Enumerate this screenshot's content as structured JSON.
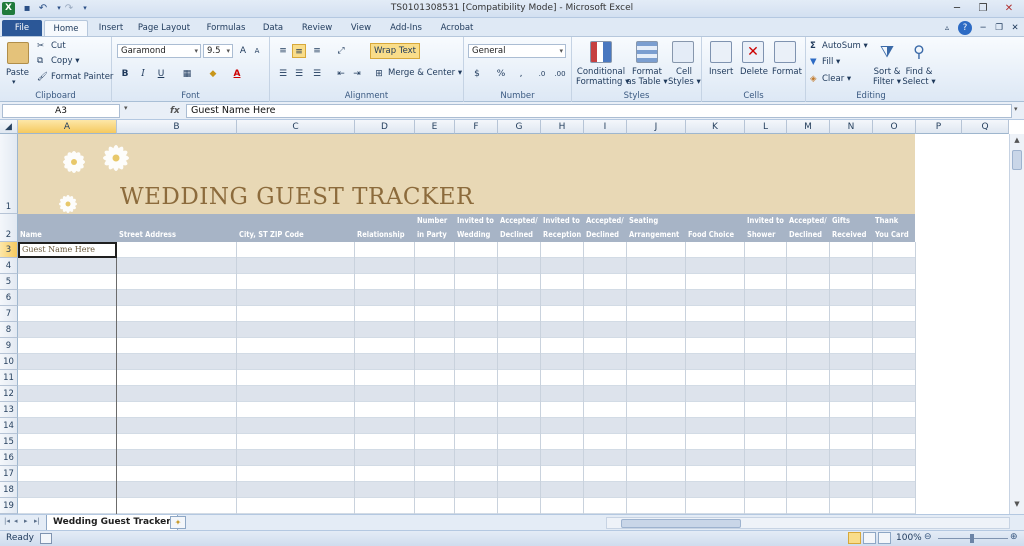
{
  "window": {
    "title": "TS0101308531  [Compatibility Mode]  -  Microsoft Excel"
  },
  "tabs": [
    "File",
    "Home",
    "Insert",
    "Page Layout",
    "Formulas",
    "Data",
    "Review",
    "View",
    "Add-Ins",
    "Acrobat"
  ],
  "ribbon": {
    "clipboard": {
      "label": "Clipboard",
      "paste": "Paste",
      "cut": "Cut",
      "copy": "Copy ▾",
      "format_painter": "Format Painter"
    },
    "font": {
      "label": "Font",
      "name": "Garamond",
      "size": "9.5"
    },
    "alignment": {
      "label": "Alignment",
      "wrap": "Wrap Text",
      "merge": "Merge & Center ▾"
    },
    "number": {
      "label": "Number",
      "format": "General"
    },
    "styles": {
      "label": "Styles",
      "conditional": [
        "Conditional",
        "Formatting ▾"
      ],
      "table": [
        "Format",
        "as Table ▾"
      ],
      "cell": [
        "Cell",
        "Styles ▾"
      ]
    },
    "cells": {
      "label": "Cells",
      "insert": "Insert",
      "delete": "Delete",
      "format": "Format"
    },
    "editing": {
      "label": "Editing",
      "autosum": "AutoSum ▾",
      "fill": "Fill ▾",
      "clear": "Clear ▾",
      "sort": [
        "Sort &",
        "Filter ▾"
      ],
      "find": [
        "Find &",
        "Select ▾"
      ]
    }
  },
  "formula_bar": {
    "name_box": "A3",
    "fx": "fx",
    "content": "Guest Name Here"
  },
  "columns": [
    "A",
    "B",
    "C",
    "D",
    "E",
    "F",
    "G",
    "H",
    "I",
    "J",
    "K",
    "L",
    "M",
    "N",
    "O",
    "P",
    "Q"
  ],
  "rows": [
    "1",
    "2",
    "3",
    "4",
    "5",
    "6",
    "7",
    "8",
    "9",
    "10",
    "11",
    "12",
    "13",
    "14",
    "15",
    "16",
    "17",
    "18",
    "19"
  ],
  "sheet": {
    "title": "WEDDING GUEST TRACKER",
    "headers": [
      [
        "",
        "Name"
      ],
      [
        "",
        "Street Address"
      ],
      [
        "",
        "City, ST  ZIP Code"
      ],
      [
        "",
        "Relationship"
      ],
      [
        "Number",
        "in Party"
      ],
      [
        "Invited to",
        "Wedding"
      ],
      [
        "Accepted/",
        "Declined"
      ],
      [
        "Invited to",
        "Reception"
      ],
      [
        "Accepted/",
        "Declined"
      ],
      [
        "Seating",
        "Arrangement"
      ],
      [
        "",
        "Food Choice"
      ],
      [
        "Invited to",
        "Shower"
      ],
      [
        "Accepted/",
        "Declined"
      ],
      [
        "Gifts",
        "Received"
      ],
      [
        "Thank",
        "You Card"
      ]
    ],
    "a3": "Guest Name Here"
  },
  "sheet_tab": "Wedding Guest Tracker",
  "status": {
    "ready": "Ready",
    "zoom": "100%"
  },
  "colors": {
    "banner": "#e8d8b5",
    "header": "#a7b4c6",
    "title": "#8c6b3c",
    "stripe": "#dde3ec"
  }
}
